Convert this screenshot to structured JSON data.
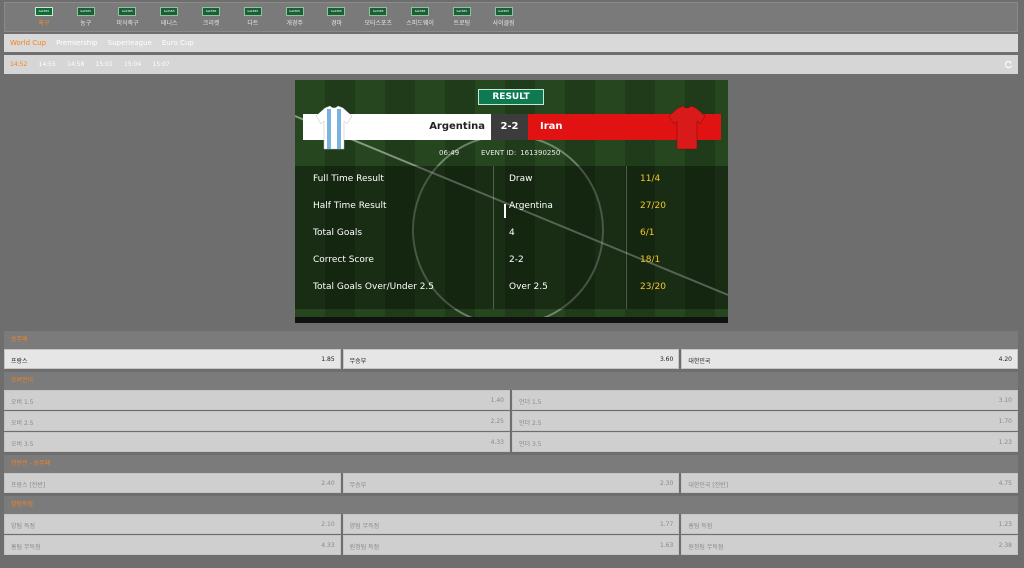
{
  "sports": [
    {
      "badge": "bet365",
      "label": "축구",
      "active": true
    },
    {
      "badge": "bet365",
      "label": "농구"
    },
    {
      "badge": "bet365",
      "label": "미식축구"
    },
    {
      "badge": "bet365",
      "label": "테니스"
    },
    {
      "badge": "bet365",
      "label": "크리켓"
    },
    {
      "badge": "bet365",
      "label": "다트"
    },
    {
      "badge": "bet365",
      "label": "개경주"
    },
    {
      "badge": "bet365",
      "label": "경마"
    },
    {
      "badge": "bet365",
      "label": "모터스포츠"
    },
    {
      "badge": "bet365",
      "label": "스피드웨이"
    },
    {
      "badge": "bet365",
      "label": "트로팅"
    },
    {
      "badge": "bet365",
      "label": "사이클링"
    }
  ],
  "leagues": [
    "World Cup",
    "Premiership",
    "Superleague",
    "Euro Cup"
  ],
  "times": [
    "14:52",
    "14:55",
    "14:58",
    "15:01",
    "15:04",
    "15:07"
  ],
  "video": {
    "result_label": "RESULT",
    "home_team": "Argentina",
    "away_team": "Iran",
    "score": "2-2",
    "match_time": "06:49",
    "event_id_label": "EVENT ID:",
    "event_id": "161390250",
    "markets": [
      {
        "name": "Full Time Result",
        "selection": "Draw",
        "odds": "11/4"
      },
      {
        "name": "Half Time Result",
        "selection": "Argentina",
        "odds": "27/20"
      },
      {
        "name": "Total Goals",
        "selection": "4",
        "odds": "6/1"
      },
      {
        "name": "Correct Score",
        "selection": "2-2",
        "odds": "18/1"
      },
      {
        "name": "Total Goals Over/Under 2.5",
        "selection": "Over 2.5",
        "odds": "23/20"
      }
    ],
    "colors": {
      "home": "#ffffff",
      "away": "#e01212",
      "odds": "#f2c72a",
      "result_tab": "#0f7a52"
    }
  },
  "sections": [
    {
      "title": "승무패",
      "rows": [
        [
          {
            "name": "프랑스",
            "odds": "1.85"
          },
          {
            "name": "무승부",
            "odds": "3.60"
          },
          {
            "name": "대한민국",
            "odds": "4.20"
          }
        ]
      ],
      "dim": false
    },
    {
      "title": "오버언더",
      "rows": [
        [
          {
            "name": "오버 1.5",
            "odds": "1.40"
          },
          {
            "name": "언더 1.5",
            "odds": "3.10"
          }
        ],
        [
          {
            "name": "오버 2.5",
            "odds": "2.25"
          },
          {
            "name": "언더 2.5",
            "odds": "1.70"
          }
        ],
        [
          {
            "name": "오버 3.5",
            "odds": "4.33"
          },
          {
            "name": "언더 3.5",
            "odds": "1.23"
          }
        ]
      ],
      "dim": true
    },
    {
      "title": "전반전 - 승무패",
      "rows": [
        [
          {
            "name": "프랑스 [전반]",
            "odds": "2.40"
          },
          {
            "name": "무승부",
            "odds": "2.30"
          },
          {
            "name": "대한민국 [전반]",
            "odds": "4.75"
          }
        ]
      ],
      "dim": true
    },
    {
      "title": "양팀득점",
      "rows": [
        [
          {
            "name": "양팀 득점",
            "odds": "2.10"
          },
          {
            "name": "양팀 무득점",
            "odds": "1.77"
          },
          {
            "name": "홈팀 득점",
            "odds": "1.23"
          }
        ],
        [
          {
            "name": "홈팀 무득점",
            "odds": "4.33"
          },
          {
            "name": "원정팀 득점",
            "odds": "1.63"
          },
          {
            "name": "원정팀 무득점",
            "odds": "2.38"
          }
        ]
      ],
      "dim": true
    }
  ]
}
